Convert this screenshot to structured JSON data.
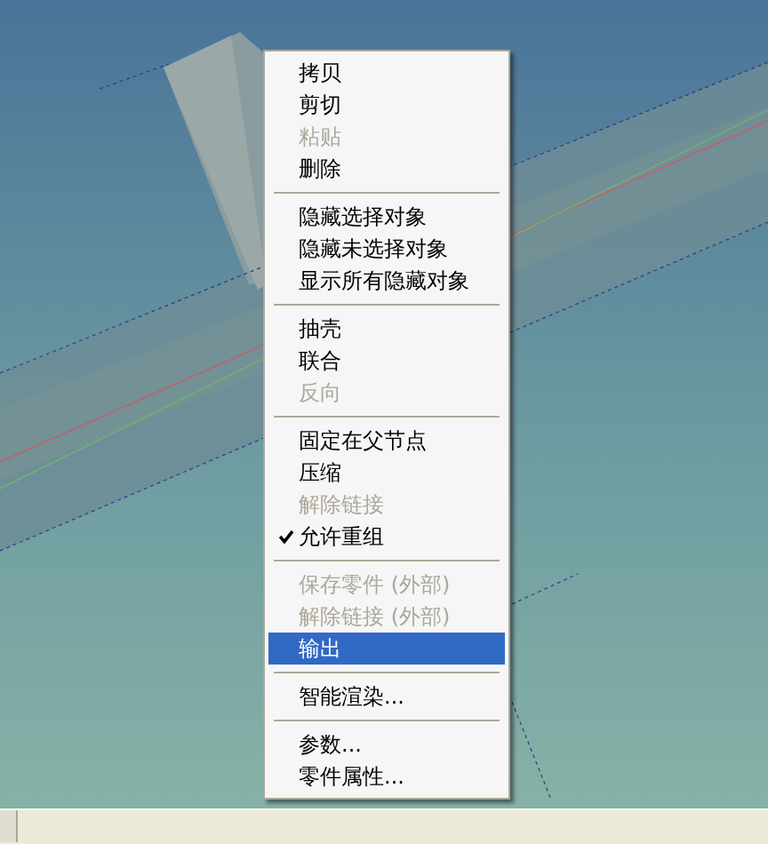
{
  "context_menu": {
    "groups": [
      [
        {
          "label": "拷贝",
          "disabled": false,
          "checked": false,
          "selected": false
        },
        {
          "label": "剪切",
          "disabled": false,
          "checked": false,
          "selected": false
        },
        {
          "label": "粘贴",
          "disabled": true,
          "checked": false,
          "selected": false
        },
        {
          "label": "删除",
          "disabled": false,
          "checked": false,
          "selected": false
        }
      ],
      [
        {
          "label": "隐藏选择对象",
          "disabled": false,
          "checked": false,
          "selected": false
        },
        {
          "label": "隐藏未选择对象",
          "disabled": false,
          "checked": false,
          "selected": false
        },
        {
          "label": "显示所有隐藏对象",
          "disabled": false,
          "checked": false,
          "selected": false
        }
      ],
      [
        {
          "label": "抽壳",
          "disabled": false,
          "checked": false,
          "selected": false
        },
        {
          "label": "联合",
          "disabled": false,
          "checked": false,
          "selected": false
        },
        {
          "label": "反向",
          "disabled": true,
          "checked": false,
          "selected": false
        }
      ],
      [
        {
          "label": "固定在父节点",
          "disabled": false,
          "checked": false,
          "selected": false
        },
        {
          "label": "压缩",
          "disabled": false,
          "checked": false,
          "selected": false
        },
        {
          "label": "解除链接",
          "disabled": true,
          "checked": false,
          "selected": false
        },
        {
          "label": "允许重组",
          "disabled": false,
          "checked": true,
          "selected": false
        }
      ],
      [
        {
          "label": "保存零件 (外部)",
          "disabled": true,
          "checked": false,
          "selected": false
        },
        {
          "label": "解除链接 (外部)",
          "disabled": true,
          "checked": false,
          "selected": false
        },
        {
          "label": "输出",
          "disabled": false,
          "checked": false,
          "selected": true
        }
      ],
      [
        {
          "label": "智能渲染...",
          "disabled": false,
          "checked": false,
          "selected": false
        }
      ],
      [
        {
          "label": "参数...",
          "disabled": false,
          "checked": false,
          "selected": false
        },
        {
          "label": "零件属性...",
          "disabled": false,
          "checked": false,
          "selected": false
        }
      ]
    ]
  }
}
